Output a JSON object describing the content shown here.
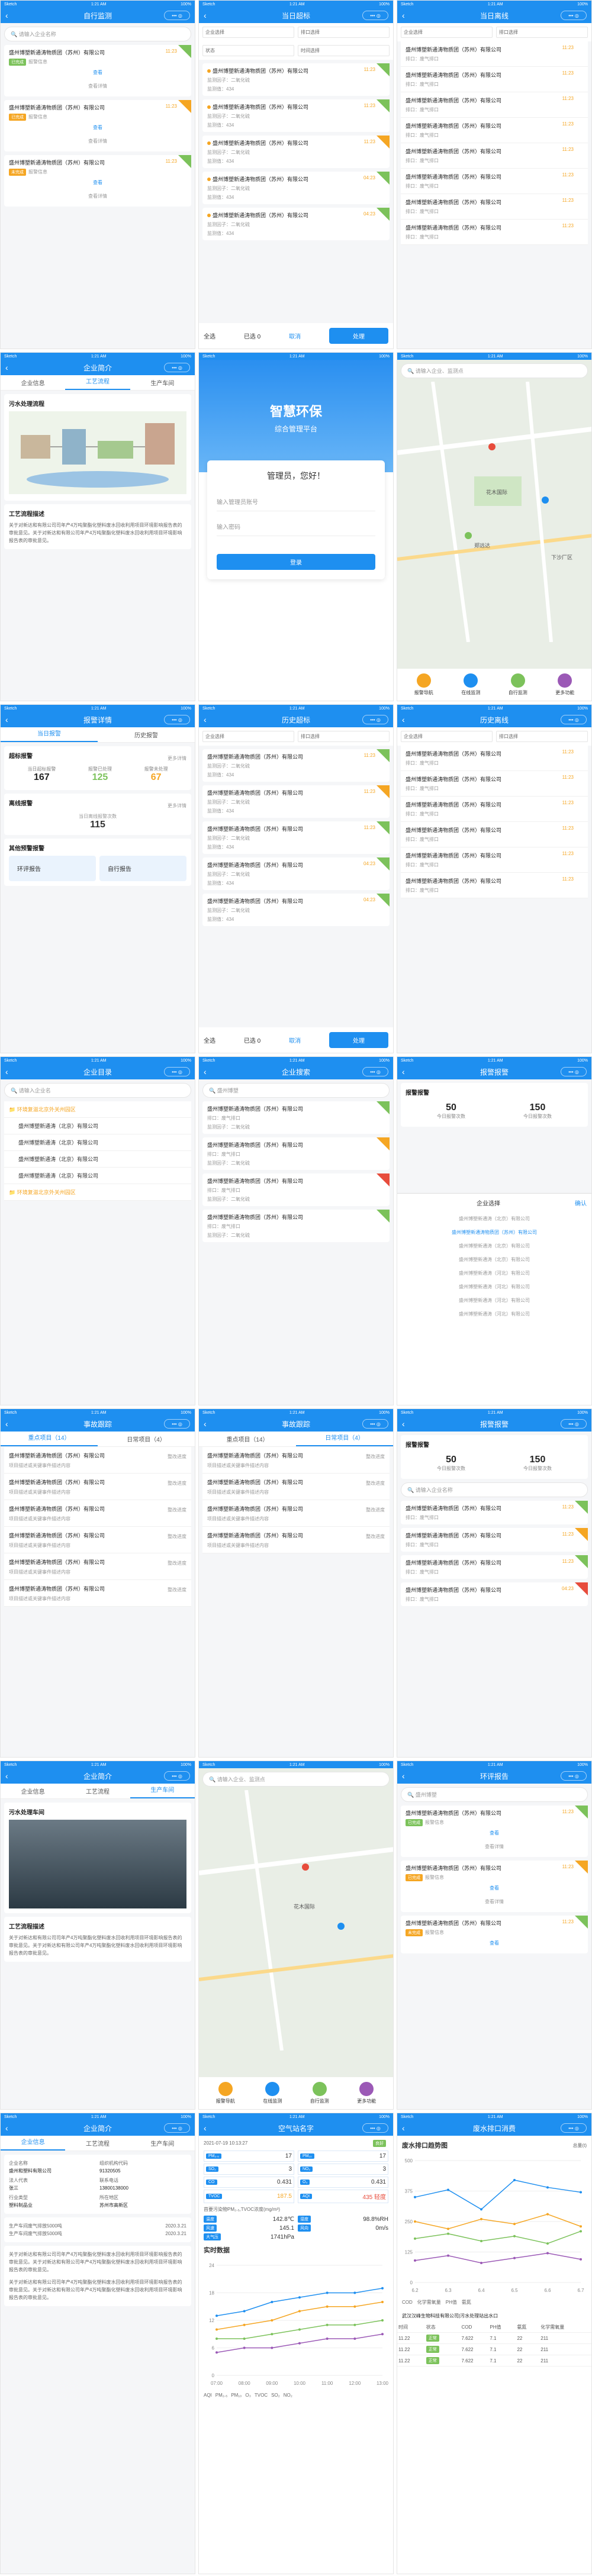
{
  "status": {
    "left": "Sketch",
    "time": "1:21 AM",
    "right": "100%"
  },
  "s1": {
    "title": "自行监测",
    "search": "请输入企业名称",
    "items": [
      {
        "name": "盛州博塑新通涛物质团（苏州）有限公司",
        "time": "11:23",
        "tag": "已完成",
        "desc": "报警信息",
        "btn": "查看",
        "more": "查看详情"
      },
      {
        "name": "盛州博塑新通涛物质团（苏州）有限公司",
        "time": "11:23",
        "tag": "已完成",
        "desc": "报警信息",
        "btn": "查看",
        "more": "查看详情"
      },
      {
        "name": "盛州博塑新通涛物质团（苏州）有限公司",
        "time": "11:23",
        "tag": "未完成",
        "desc": "报警信息",
        "btn": "查看",
        "more": "查看详情"
      }
    ]
  },
  "s2": {
    "title": "当日超标",
    "f1": "企业选择",
    "f2": "排口选择",
    "f3": "状态",
    "f4": "时间选择",
    "items": [
      {
        "name": "盛州博塑新通涛物质团（苏州）有限公司",
        "time": "11:23",
        "a": "超标时间：",
        "b": "监测因子：二氧化硫",
        "v": "监测值：434"
      },
      {
        "name": "盛州博塑新通涛物质团（苏州）有限公司",
        "time": "11:23",
        "a": "超标时间：",
        "b": "监测因子：二氧化硫",
        "v": "监测值：434"
      },
      {
        "name": "盛州博塑新通涛物质团（苏州）有限公司",
        "time": "11:23",
        "a": "超标时间：",
        "b": "监测因子：二氧化硫",
        "v": "监测值：434"
      },
      {
        "name": "盛州博塑新通涛物质团（苏州）有限公司",
        "time": "04:23",
        "a": "超标时间：",
        "b": "监测因子：二氧化硫",
        "v": "监测值：434"
      },
      {
        "name": "盛州博塑新通涛物质团（苏州）有限公司",
        "time": "04:23",
        "a": "超标时间：",
        "b": "监测因子：二氧化硫",
        "v": "监测值：434"
      }
    ],
    "foot": {
      "a": "全选",
      "b": "已选 0",
      "c": "取消",
      "btn": "处理"
    }
  },
  "s3": {
    "title": "当日离线",
    "f1": "企业选择",
    "f2": "排口选择",
    "items": [
      "盛州博塑新通涛物质团（苏州）有限公司",
      "盛州博塑新通涛物质团（苏州）有限公司",
      "盛州博塑新通涛物质团（苏州）有限公司",
      "盛州博塑新通涛物质团（苏州）有限公司",
      "盛州博塑新通涛物质团（苏州）有限公司",
      "盛州博塑新通涛物质团（苏州）有限公司",
      "盛州博塑新通涛物质团（苏州）有限公司",
      "盛州博塑新通涛物质团（苏州）有限公司"
    ],
    "time": "11:23",
    "sub": "排口：废气排口"
  },
  "s4": {
    "title": "企业简介",
    "tabs": [
      "企业信息",
      "工艺流程",
      "生产车间"
    ],
    "h": "污水处理流程",
    "d": "工艺流程描述",
    "p": "关于对新达和有限公司司年产4万吨聚酯化塑料废水回收利用项目环境影响报告表的审批意见。关于对新达和有限公司年产4万吨聚酯化塑料废水回收利用项目环境影响报告表的审批意见。"
  },
  "s5": {
    "t1": "智慧环保",
    "t2": "综合管理平台",
    "hello": "管理员，您好！",
    "u": "输入管理员账号",
    "p": "输入密码",
    "btn": "登录"
  },
  "s6": {
    "search": "请输入企业、监测点",
    "labels": [
      "花木国际",
      "下沙厂区",
      "郑远达"
    ],
    "nav": [
      "报警导航",
      "在线监测",
      "自行监测",
      "更多功能"
    ]
  },
  "s7": {
    "title": "报警详情",
    "tabs": [
      "当日报警",
      "历史报警"
    ],
    "h1": "超标报警",
    "k": [
      [
        "当日超标报警",
        "167"
      ],
      [
        "报警已处理",
        "125"
      ],
      [
        "报警未处理",
        "67"
      ]
    ],
    "h2": "离线报警",
    "m1": "当日离线报警次数",
    "n1": "115",
    "h3": "其他预警报警",
    "o1": "环评报告",
    "o2": "自行报告",
    "more": "更多详情"
  },
  "s8": {
    "title": "历史超标"
  },
  "s9": {
    "title": "历史离线"
  },
  "s10": {
    "title": "企业目录",
    "search": "请输入企业名",
    "g1": "环境复滋北京外关州园区",
    "items": [
      "盛州博塑新通涛（北京）有限公司",
      "盛州博塑新通涛（北京）有限公司",
      "盛州博塑新通涛（北京）有限公司",
      "盛州博塑新通涛（北京）有限公司"
    ],
    "g2": "环境复滋北京外关州园区"
  },
  "s11": {
    "title": "企业搜索",
    "search": "盛州博塑",
    "sub1": "排口：废气排口",
    "sub2": "监测因子：二氧化硫"
  },
  "s12": {
    "title": "报警报警",
    "h": "报警报警",
    "a": "50",
    "al": "今日报警次数",
    "b": "150",
    "bl": "今日报警次数",
    "pick": "企业选择",
    "ok": "确认",
    "opts": [
      "盛州博塑新通涛（北京）有限公司",
      "盛州博塑新通涛物质团（苏州）有限公司",
      "盛州博塑新通涛（北京）有限公司",
      "盛州博塑新通涛（北京）有限公司",
      "盛州博塑新通涛（河北）有限公司",
      "盛州博塑新通涛（河北）有限公司",
      "盛州博塑新通涛（河北）有限公司",
      "盛州博塑新通涛（河北）有限公司",
      "盛州博塑新通涛（河北）有限公司"
    ]
  },
  "s13": {
    "title": "事故跟踪",
    "tabs": [
      "重点项目（14）",
      "日常项目（4）"
    ],
    "items": [
      "盛州博塑新通涛物质团（苏州）有限公司",
      "盛州博塑新通涛物质团（苏州）有限公司",
      "盛州博塑新通涛物质团（苏州）有限公司",
      "盛州博塑新通涛物质团（苏州）有限公司",
      "盛州博塑新通涛物质团（苏州）有限公司",
      "盛州博塑新通涛物质团（苏州）有限公司",
      "盛州博塑新通涛物质团（苏州）有限公司"
    ],
    "st": "整改进度",
    "desc": "项目描述或关键事件描述内容"
  },
  "s14": {
    "title": "事故跟踪"
  },
  "s15": {
    "title": "报警报警"
  },
  "s16": {
    "title": "企业简介",
    "h": "污水处理车间"
  },
  "s17": {
    "search": "请输入企业、监测点"
  },
  "s18": {
    "title": "环评报告",
    "search": "盛州博塑"
  },
  "s19": {
    "title": "企业简介",
    "tabs": [
      "企业信息",
      "工艺流程",
      "生产车间"
    ],
    "rows": [
      [
        "企业名称",
        "盛州和塑料有限公司"
      ],
      [
        "组织机构代码",
        "91320505"
      ],
      [
        "法人代表",
        "张三"
      ],
      [
        "联系电话",
        "13800138000"
      ],
      [
        "行业类型",
        "塑料制品业"
      ],
      [
        "所在地区",
        "苏州市高新区"
      ]
    ],
    "log": [
      "生产车间废气排放5000吨",
      "生产车间废气排放5000吨"
    ],
    "d1": "2020.3.21",
    "d2": "2020.3.21"
  },
  "s20": {
    "title": "空气站名字",
    "date": "2021-07-19 10:13:27",
    "tag": "良好",
    "vals": [
      [
        "PM₂.₅",
        "17"
      ],
      [
        "PM₁₀",
        "17"
      ],
      [
        "SO₂",
        "3"
      ],
      [
        "NO₂",
        "3"
      ],
      [
        "CO",
        "0.431"
      ],
      [
        "O₃",
        "0.431"
      ],
      [
        "TVOC",
        "187.5"
      ],
      [
        "AQI",
        "435 轻度"
      ]
    ],
    "note": "首要污染物PM₂.₅,TVOC浓度(mg/m³)",
    "env": [
      [
        "温度",
        "142.8℃"
      ],
      [
        "湿度",
        "98.8%RH"
      ],
      [
        "风速",
        "145.1"
      ],
      [
        "风向",
        "0m/s"
      ],
      [
        "大气压",
        "1741hPa"
      ]
    ],
    "rt": "实时数据",
    "legend": [
      "AQI",
      "PM₂.₅",
      "PM₁₀",
      "O₃",
      "TVOC",
      "SO₂",
      "NO₂"
    ]
  },
  "s21": {
    "title": "废水排口消费",
    "chart": "废水排口趋势图",
    "unit": "总量(t)",
    "xs": [
      "6.2",
      "6.3",
      "6.4",
      "6.5",
      "6.6",
      "6.7"
    ],
    "legend": [
      "COD",
      "化学需氧量",
      "PH值",
      "氨氮"
    ],
    "tbl": "武汉汉峰生物科技有限公司|污水处理站出水口",
    "head": [
      "时间",
      "状态",
      "COD",
      "PH值",
      "氨氮",
      "化学需氧量"
    ],
    "rows": [
      [
        "11.22",
        "正常",
        "7.622",
        "7.1",
        "22",
        "211"
      ],
      [
        "11.22",
        "正常",
        "7.622",
        "7.1",
        "22",
        "211"
      ],
      [
        "11.22",
        "正常",
        "7.622",
        "7.1",
        "22",
        "211"
      ]
    ]
  },
  "chart_data": [
    {
      "type": "line",
      "title": "实时数据",
      "categories": [
        "07:00",
        "08:00",
        "09:00",
        "10:00",
        "11:00",
        "12:00",
        "13:00"
      ],
      "ylim": [
        0,
        24
      ],
      "series": [
        {
          "name": "AQI",
          "values": [
            13,
            14,
            16,
            17,
            18,
            18,
            19
          ]
        },
        {
          "name": "PM₂.₅",
          "values": [
            10,
            11,
            12,
            14,
            15,
            15,
            16
          ]
        },
        {
          "name": "PM₁₀",
          "values": [
            8,
            8,
            9,
            10,
            11,
            11,
            12
          ]
        },
        {
          "name": "O₃",
          "values": [
            5,
            6,
            6,
            7,
            8,
            8,
            9
          ]
        }
      ]
    },
    {
      "type": "line",
      "title": "废水排口趋势图",
      "categories": [
        "6.2",
        "6.3",
        "6.4",
        "6.5",
        "6.6",
        "6.7"
      ],
      "ylim": [
        0,
        500
      ],
      "series": [
        {
          "name": "COD",
          "values": [
            350,
            380,
            300,
            420,
            390,
            370
          ]
        },
        {
          "name": "化学需氧量",
          "values": [
            250,
            220,
            260,
            240,
            280,
            230
          ]
        },
        {
          "name": "PH值",
          "values": [
            180,
            200,
            170,
            190,
            160,
            210
          ]
        },
        {
          "name": "氨氮",
          "values": [
            90,
            110,
            80,
            100,
            120,
            95
          ]
        }
      ]
    }
  ]
}
